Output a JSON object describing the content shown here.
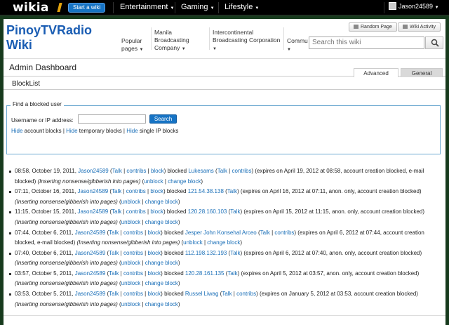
{
  "global_nav": {
    "logo": "wikia",
    "start_wiki": "Start a wiki",
    "hubs": [
      "Entertainment",
      "Gaming",
      "Lifestyle"
    ],
    "username": "Jason24589"
  },
  "wiki": {
    "name_line1": "PinoyTVRadio",
    "name_line2": "Wiki",
    "nav": [
      {
        "line1": "Popular",
        "line2": "pages"
      },
      {
        "line1": "Manila",
        "line2": "Broadcasting",
        "line3": "Company"
      },
      {
        "line1": "Intercontinental",
        "line2": "Broadcasting Corporation"
      },
      {
        "line1": "Commu"
      }
    ],
    "random_page": "Random Page",
    "wiki_activity": "Wiki Activity",
    "search_placeholder": "Search this wiki"
  },
  "admin": {
    "title": "Admin Dashboard",
    "tabs": [
      "Advanced",
      "General"
    ],
    "special_title": "BlockList"
  },
  "find_form": {
    "legend": "Find a blocked user",
    "label": "Username or IP address:",
    "button": "Search",
    "hide1": "Hide",
    "text1": " account blocks | ",
    "hide2": "Hide",
    "text2": " temporary blocks | ",
    "hide3": "Hide",
    "text3": " single IP blocks"
  },
  "entries": [
    {
      "time": "08:58, October 19, 2011, ",
      "admin": "Jason24589",
      "target": "Lukesams",
      "target_contribs": true,
      "details": " (expires on April 19, 2012 at 08:58, account creation blocked, e-mail blocked) ",
      "reason": "(Inserting nonsense/gibberish into pages)"
    },
    {
      "time": "07:11, October 16, 2011, ",
      "admin": "Jason24589",
      "target": "121.54.38.138",
      "target_contribs": false,
      "details": " (expires on April 16, 2012 at 07:11, anon. only, account creation blocked) ",
      "reason": "(Inserting nonsense/gibberish into pages)"
    },
    {
      "time": "11:15, October 15, 2011, ",
      "admin": "Jason24589",
      "target": "120.28.160.103",
      "target_contribs": false,
      "details": " (expires on April 15, 2012 at 11:15, anon. only, account creation blocked) ",
      "reason": "(Inserting nonsense/gibberish into pages)"
    },
    {
      "time": "07:44, October 6, 2011, ",
      "admin": "Jason24589",
      "target": "Jesper John Konsehal Arceo",
      "target_contribs": true,
      "details": " (expires on April 6, 2012 at 07:44, account creation blocked, e-mail blocked) ",
      "reason": "(Inserting nonsense/gibberish into pages)"
    },
    {
      "time": "07:40, October 6, 2011, ",
      "admin": "Jason24589",
      "target": "112.198.132.193",
      "target_contribs": false,
      "details": " (expires on April 6, 2012 at 07:40, anon. only, account creation blocked) ",
      "reason": "(Inserting nonsense/gibberish into pages)"
    },
    {
      "time": "03:57, October 5, 2011, ",
      "admin": "Jason24589",
      "target": "120.28.161.135",
      "target_contribs": false,
      "details": " (expires on April 5, 2012 at 03:57, anon. only, account creation blocked) ",
      "reason": "(Inserting nonsense/gibberish into pages)"
    },
    {
      "time": "03:53, October 5, 2011, ",
      "admin": "Jason24589",
      "target": "Russel Liwag",
      "target_contribs": true,
      "details": " (expires on January 5, 2012 at 03:53, account creation blocked) ",
      "reason": "(Inserting nonsense/gibberish into pages)"
    }
  ],
  "strings": {
    "talk": "Talk",
    "contribs": "contribs",
    "block": "block",
    "blocked": " blocked ",
    "unblock": "unblock",
    "change_block": "change block",
    "sep": " | ",
    "open": " (",
    "close": ")"
  }
}
